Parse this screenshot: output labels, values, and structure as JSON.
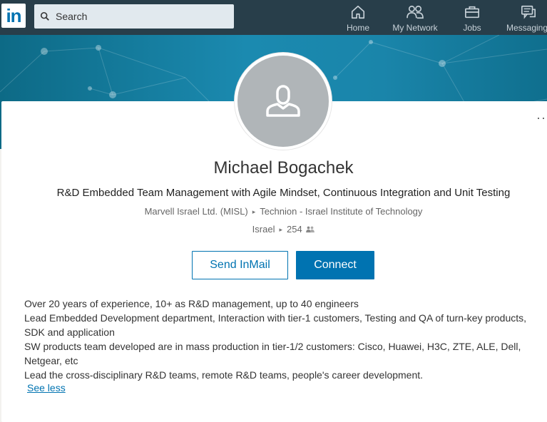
{
  "nav": {
    "logo": "in",
    "search_placeholder": "Search",
    "items": [
      {
        "label": "Home",
        "icon": "home-icon"
      },
      {
        "label": "My Network",
        "icon": "network-icon"
      },
      {
        "label": "Jobs",
        "icon": "briefcase-icon"
      },
      {
        "label": "Messaging",
        "icon": "messaging-icon"
      }
    ]
  },
  "profile": {
    "name": "Michael Bogachek",
    "headline": "R&D Embedded Team Management with Agile Mindset, Continuous Integration and Unit Testing",
    "company": "Marvell Israel Ltd. (MISL)",
    "school": "Technion - Israel Institute of Technology",
    "location": "Israel",
    "connections": "254",
    "actions": {
      "inmail": "Send InMail",
      "connect": "Connect"
    },
    "summary": [
      "Over 20 years of experience, 10+ as R&D management, up to 40 engineers",
      "Lead Embedded Development department, Interaction with tier-1 customers, Testing and QA of turn-key products, SDK and application",
      "SW products team developed are in mass production in tier-1/2 customers: Cisco, Huawei, H3C, ZTE, ALE, Dell, Netgear, etc",
      "Lead the cross-disciplinary R&D teams, remote R&D teams, people's career development."
    ],
    "see_less": "See less"
  },
  "colors": {
    "nav_bg": "#283e4a",
    "brand_blue": "#0073b1",
    "banner": "#1b8ab0"
  }
}
